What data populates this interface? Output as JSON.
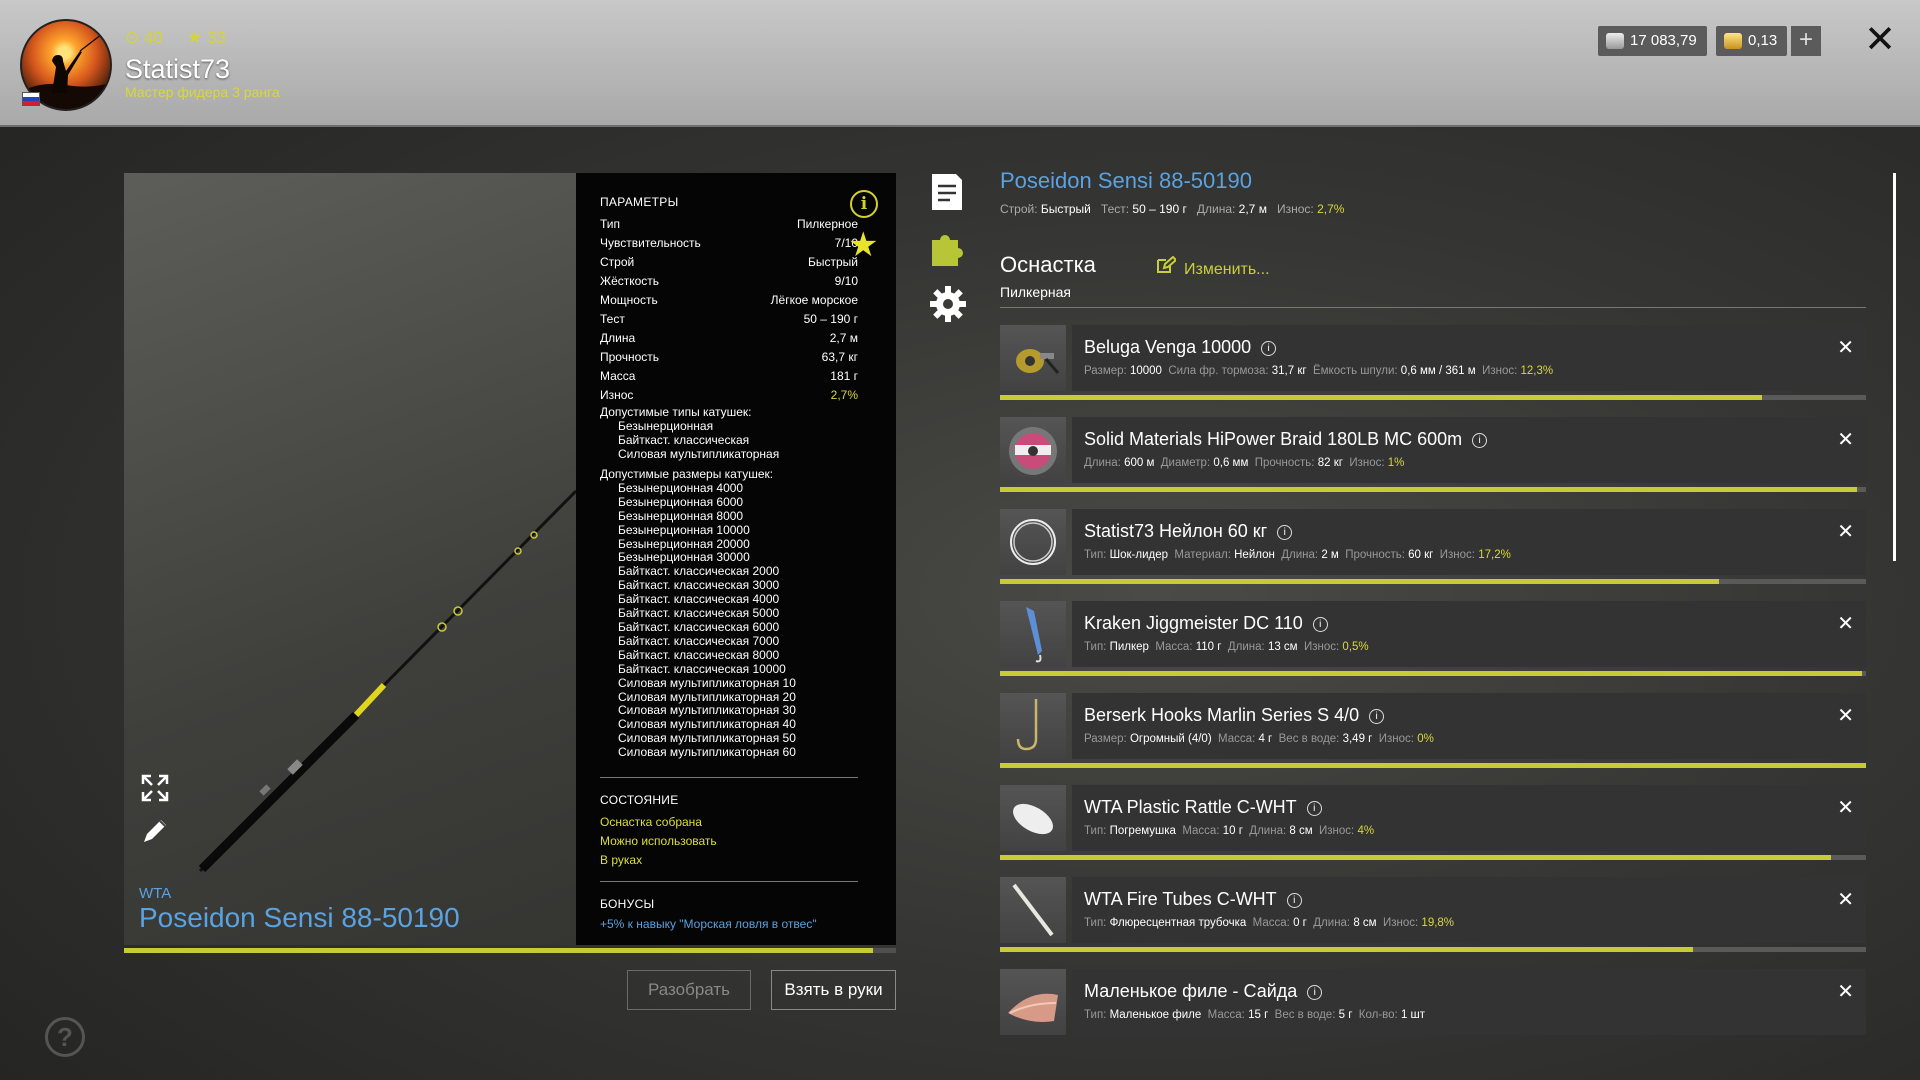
{
  "user": {
    "coins": "40",
    "stars": "33",
    "name": "Statist73",
    "rank": "Мастер фидера 3 ранга"
  },
  "currency": {
    "silver": "17 083,79",
    "gold": "0,13"
  },
  "params": {
    "heading": "ПАРАМЕТРЫ",
    "rows": [
      {
        "k": "Тип",
        "v": "Пилкерное"
      },
      {
        "k": "Чувствительность",
        "v": "7/10"
      },
      {
        "k": "Строй",
        "v": "Быстрый"
      },
      {
        "k": "Жёсткость",
        "v": "9/10"
      },
      {
        "k": "Мощность",
        "v": "Лёгкое морское"
      },
      {
        "k": "Тест",
        "v": "50 – 190 г"
      },
      {
        "k": "Длина",
        "v": "2,7 м"
      },
      {
        "k": "Прочность",
        "v": "63,7 кг"
      },
      {
        "k": "Масса",
        "v": "181 г"
      },
      {
        "k": "Износ",
        "v": "2,7%"
      }
    ],
    "reel_types_label": "Допустимые типы катушек:",
    "reel_types": [
      "Безынерционная",
      "Байткаст. классическая",
      "Силовая мультипликаторная"
    ],
    "reel_sizes_label": "Допустимые размеры катушек:",
    "reel_sizes": [
      "Безынерционная 4000",
      "Безынерционная 6000",
      "Безынерционная 8000",
      "Безынерционная 10000",
      "Безынерционная 20000",
      "Безынерционная 30000",
      "Байткаст. классическая 2000",
      "Байткаст. классическая 3000",
      "Байткаст. классическая 4000",
      "Байткаст. классическая 5000",
      "Байткаст. классическая 6000",
      "Байткаст. классическая 7000",
      "Байткаст. классическая 8000",
      "Байткаст. классическая 10000",
      "Силовая мультипликаторная 10",
      "Силовая мультипликаторная 20",
      "Силовая мультипликаторная 30",
      "Силовая мультипликаторная 40",
      "Силовая мультипликаторная 50",
      "Силовая мультипликаторная 60"
    ],
    "state_heading": "СОСТОЯНИЕ",
    "state": [
      "Оснастка собрана",
      "Можно использовать",
      "В руках"
    ],
    "bonus_heading": "БОНУСЫ",
    "bonus_text": "+5% к навыку \"Морская ловля в отвес\""
  },
  "rod": {
    "brand": "WTA",
    "name": "Poseidon Sensi 88-50190",
    "wear_fraction": 0.97,
    "stroy_label": "Строй:",
    "stroy": "Быстрый",
    "test_label": "Тест:",
    "test": "50 – 190 г",
    "length_label": "Длина:",
    "length": "2,7 м",
    "wear_label": "Износ:",
    "wear": "2,7%"
  },
  "buttons": {
    "disassemble": "Разобрать",
    "take": "Взять в руки"
  },
  "rig": {
    "heading": "Оснастка",
    "type": "Пилкерная",
    "edit": "Изменить..."
  },
  "items": [
    {
      "name": "Beluga Venga 10000",
      "fill": 0.88,
      "thumb": "reel-icon",
      "specs": [
        [
          "Размер:",
          "10000",
          false
        ],
        [
          "Сила фр. тормоза:",
          "31,7 кг",
          false
        ],
        [
          "Ёмкость шпули:",
          "0,6 мм / 361 м",
          false
        ],
        [
          "Износ:",
          "12,3%",
          true
        ]
      ]
    },
    {
      "name": "Solid Materials HiPower Braid 180LB MC 600m",
      "fill": 0.99,
      "thumb": "line-spool-icon",
      "specs": [
        [
          "Длина:",
          "600 м",
          false
        ],
        [
          "Диаметр:",
          "0,6 мм",
          false
        ],
        [
          "Прочность:",
          "82 кг",
          false
        ],
        [
          "Износ:",
          "1%",
          true
        ]
      ]
    },
    {
      "name": "Statist73 Нейлон 60 кг",
      "fill": 0.83,
      "thumb": "leader-coil-icon",
      "specs": [
        [
          "Тип:",
          "Шок-лидер",
          false
        ],
        [
          "Материал:",
          "Нейлон",
          false
        ],
        [
          "Длина:",
          "2 м",
          false
        ],
        [
          "Прочность:",
          "60 кг",
          false
        ],
        [
          "Износ:",
          "17,2%",
          true
        ]
      ]
    },
    {
      "name": "Kraken Jiggmeister DC 110",
      "fill": 0.995,
      "thumb": "pilker-icon",
      "specs": [
        [
          "Тип:",
          "Пилкер",
          false
        ],
        [
          "Масса:",
          "110 г",
          false
        ],
        [
          "Длина:",
          "13 см",
          false
        ],
        [
          "Износ:",
          "0,5%",
          true
        ]
      ]
    },
    {
      "name": "Berserk Hooks Marlin Series S 4/0",
      "fill": 1.0,
      "thumb": "hook-icon",
      "specs": [
        [
          "Размер:",
          "Огромный (4/0)",
          false
        ],
        [
          "Масса:",
          "4 г",
          false
        ],
        [
          "Вес в воде:",
          "3,49 г",
          false
        ],
        [
          "Износ:",
          "0%",
          true
        ]
      ]
    },
    {
      "name": "WTA Plastic Rattle C-WHT",
      "fill": 0.96,
      "thumb": "rattle-icon",
      "specs": [
        [
          "Тип:",
          "Погремушка",
          false
        ],
        [
          "Масса:",
          "10 г",
          false
        ],
        [
          "Длина:",
          "8 см",
          false
        ],
        [
          "Износ:",
          "4%",
          true
        ]
      ]
    },
    {
      "name": "WTA Fire Tubes C-WHT",
      "fill": 0.8,
      "thumb": "tube-icon",
      "specs": [
        [
          "Тип:",
          "Флюресцентная трубочка",
          false
        ],
        [
          "Масса:",
          "0 г",
          false
        ],
        [
          "Длина:",
          "8 см",
          false
        ],
        [
          "Износ:",
          "19,8%",
          true
        ]
      ]
    },
    {
      "name": "Маленькое филе - Сайда",
      "fill": null,
      "thumb": "fillet-icon",
      "specs": [
        [
          "Тип:",
          "Маленькое филе",
          false
        ],
        [
          "Масса:",
          "15 г",
          false
        ],
        [
          "Вес в воде:",
          "5 г",
          false
        ],
        [
          "Кол-во:",
          "1 шт",
          false
        ]
      ]
    }
  ]
}
